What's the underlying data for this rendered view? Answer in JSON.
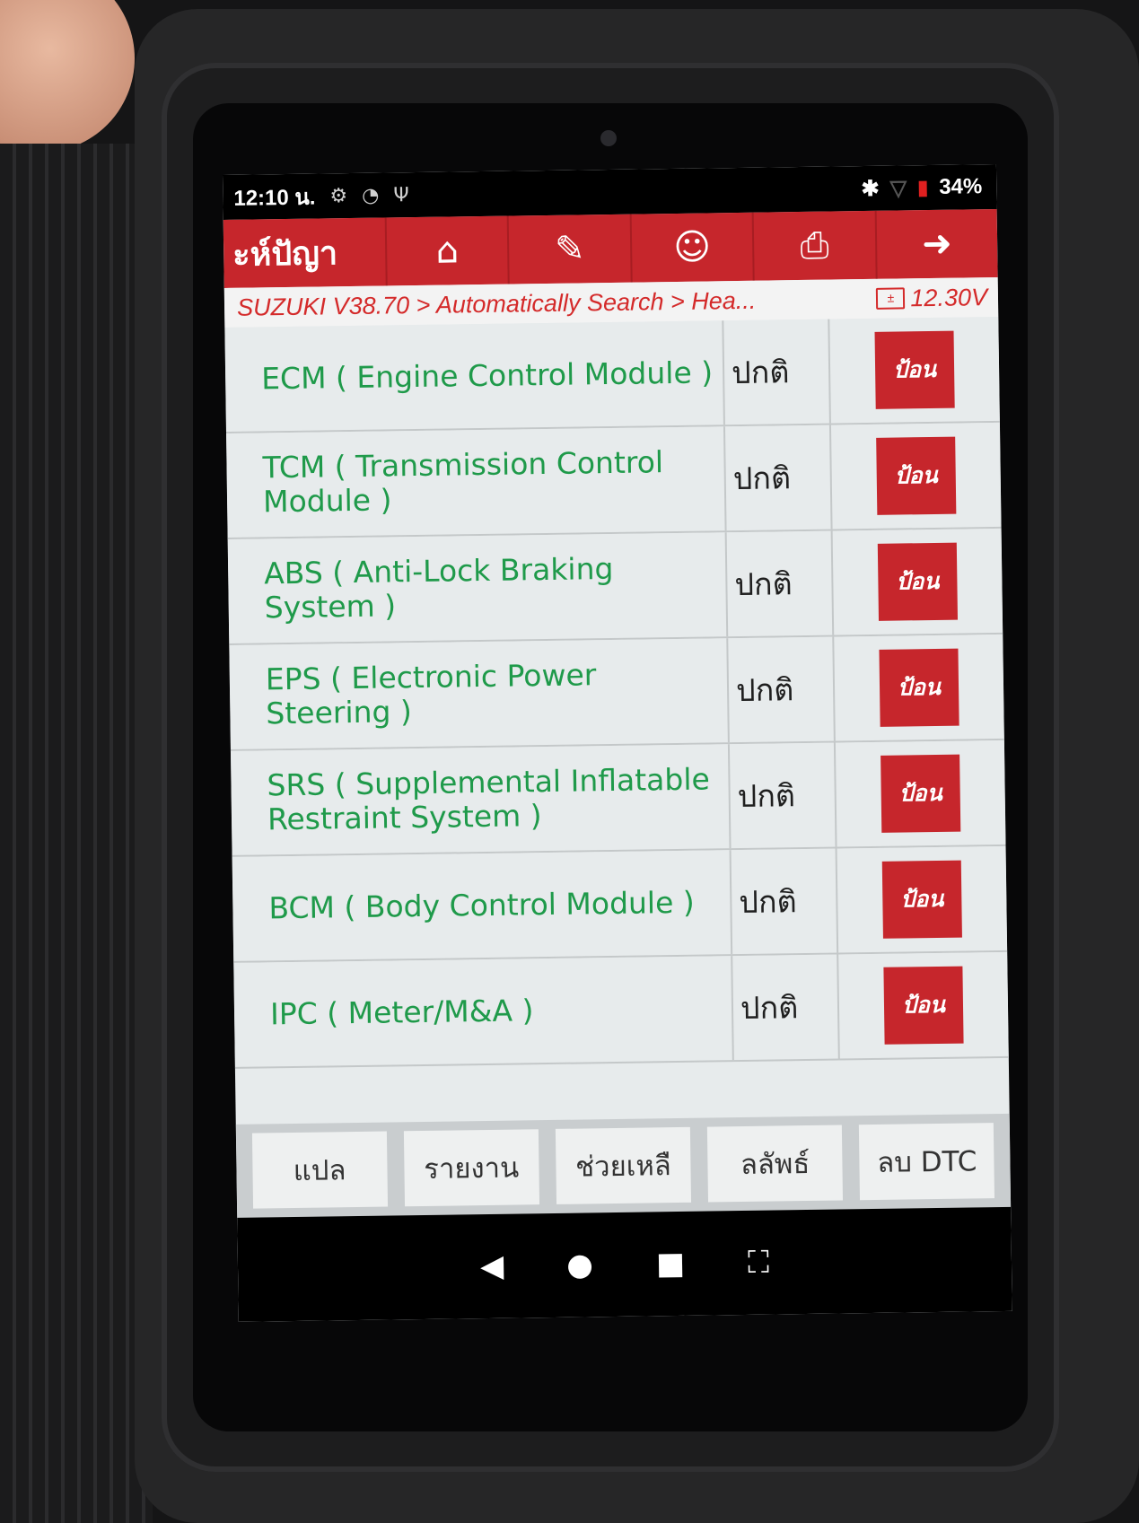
{
  "status_bar": {
    "time": "12:10 น.",
    "left_icons": [
      "settings-gear-icon",
      "wifi-icon",
      "usb-icon"
    ],
    "right_icons": [
      "bluetooth-icon",
      "signal-icon"
    ],
    "battery": "34%"
  },
  "toolbar": {
    "title": "ะห์ปัญา",
    "buttons": [
      "home-icon",
      "edit-report-icon",
      "remote-support-icon",
      "print-icon",
      "exit-icon"
    ]
  },
  "breadcrumb": {
    "path": "SUZUKI V38.70 > Automatically Search > Hea...",
    "voltage": "12.30V"
  },
  "modules": [
    {
      "name": "ECM ( Engine Control Module )",
      "status": "ปกติ",
      "action": "ป้อน"
    },
    {
      "name": "TCM ( Transmission Control Module )",
      "status": "ปกติ",
      "action": "ป้อน"
    },
    {
      "name": "ABS ( Anti-Lock Braking System )",
      "status": "ปกติ",
      "action": "ป้อน"
    },
    {
      "name": "EPS ( Electronic Power Steering )",
      "status": "ปกติ",
      "action": "ป้อน"
    },
    {
      "name": "SRS ( Supplemental Inflatable Restraint System )",
      "status": "ปกติ",
      "action": "ป้อน"
    },
    {
      "name": "BCM ( Body Control Module )",
      "status": "ปกติ",
      "action": "ป้อน"
    },
    {
      "name": "IPC ( Meter/M&A )",
      "status": "ปกติ",
      "action": "ป้อน"
    }
  ],
  "bottom_buttons": [
    "แปล",
    "รายงาน",
    "ช่วยเหลื",
    "ลลัพธ์",
    "ลบ DTC"
  ],
  "colors": {
    "accent_red": "#c6262c",
    "module_text_green": "#1f9a4a",
    "breadcrumb_red": "#d42a2a"
  }
}
